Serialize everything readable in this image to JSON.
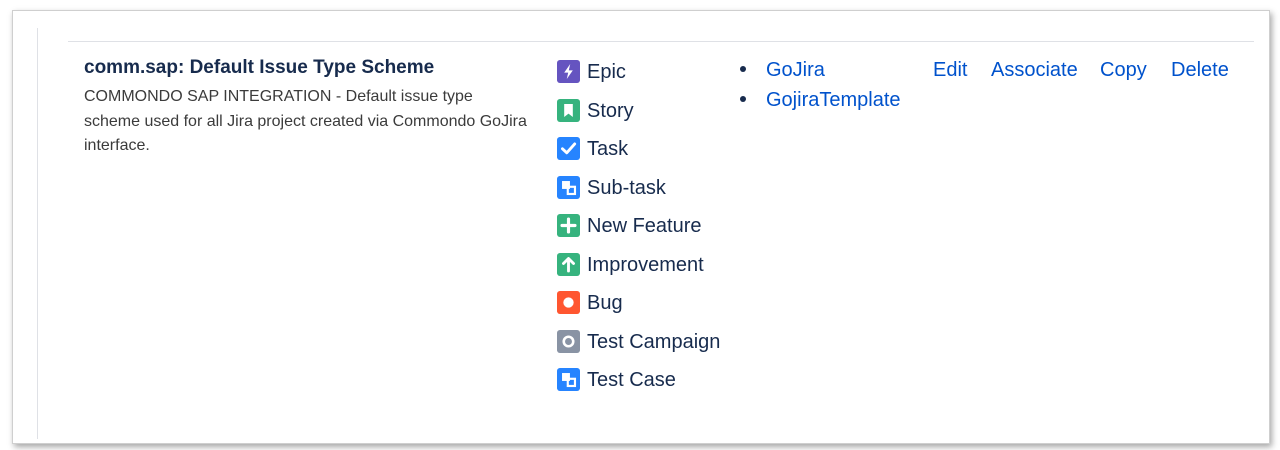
{
  "scheme": {
    "name": "comm.sap: Default Issue Type Scheme",
    "description": "COMMONDO SAP INTEGRATION - Default issue type scheme used for all Jira project created via Commondo GoJira interface."
  },
  "issue_types": [
    {
      "label": "Epic",
      "icon": "epic-icon",
      "color": "#6554c0"
    },
    {
      "label": "Story",
      "icon": "story-icon",
      "color": "#36b37e"
    },
    {
      "label": "Task",
      "icon": "task-icon",
      "color": "#2684ff"
    },
    {
      "label": "Sub-task",
      "icon": "subtask-icon",
      "color": "#2684ff"
    },
    {
      "label": "New Feature",
      "icon": "new-feature-icon",
      "color": "#36b37e"
    },
    {
      "label": "Improvement",
      "icon": "improvement-icon",
      "color": "#36b37e"
    },
    {
      "label": "Bug",
      "icon": "bug-icon",
      "color": "#ff5630"
    },
    {
      "label": "Test Campaign",
      "icon": "test-campaign-icon",
      "color": "#8993a4"
    },
    {
      "label": "Test Case",
      "icon": "test-case-icon",
      "color": "#2684ff"
    }
  ],
  "projects": [
    "GoJira",
    "GojiraTemplate"
  ],
  "operations": {
    "edit": "Edit",
    "associate": "Associate",
    "copy": "Copy",
    "delete": "Delete"
  },
  "colors": {
    "link": "#0052cc",
    "text": "#172b4d"
  }
}
